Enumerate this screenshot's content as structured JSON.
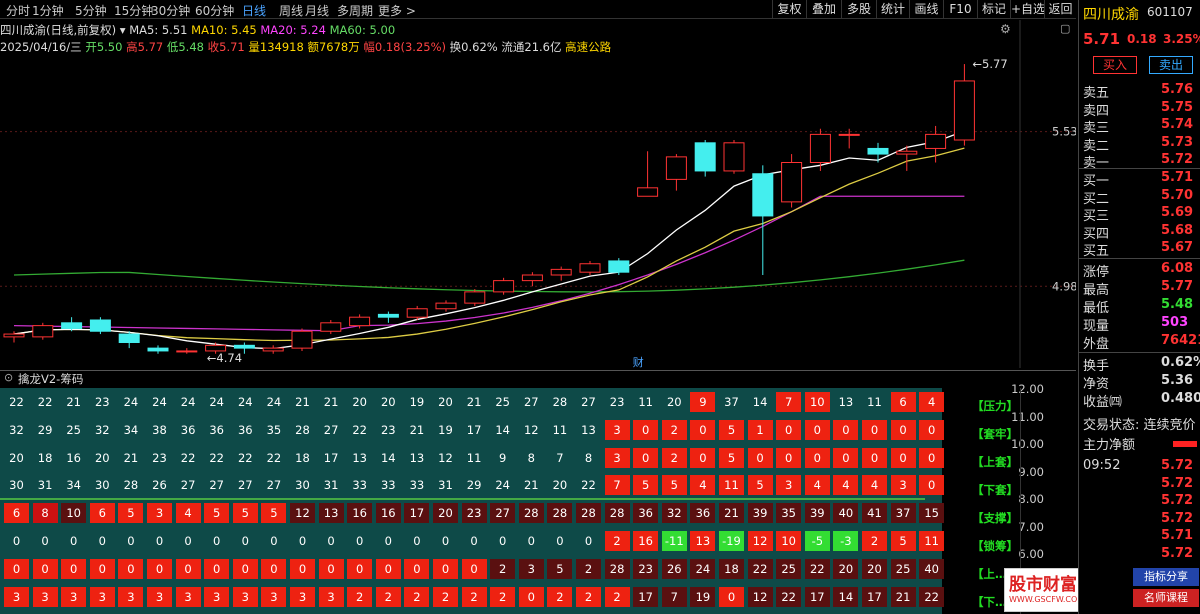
{
  "tabs": {
    "periods": [
      "分时",
      "1分钟",
      "5分钟",
      "15分钟",
      "30分钟",
      "60分钟",
      "日线",
      "周线",
      "月线",
      "多周期",
      "更多 >"
    ],
    "active": "日线",
    "buttons": [
      "复权",
      "叠加",
      "多股",
      "统计",
      "画线",
      "F10",
      "标记",
      "+自选",
      "返回"
    ]
  },
  "info": {
    "title": "四川成渝(日线,前复权)",
    "ma5": "MA5: 5.51",
    "ma10": "MA10: 5.45",
    "ma20": "MA20: 5.24",
    "ma60": "MA60: 5.00",
    "date": "2025/04/16/三",
    "open": "开5.50",
    "high": "高5.77",
    "low": "低5.48",
    "close": "收5.71",
    "vol": "量134918",
    "amount": "额7678万",
    "change": "幅0.18(3.25%)",
    "turnover": "换0.62%",
    "float": "流通21.6亿",
    "sector": "高速公路"
  },
  "chart_data": {
    "type": "candlestick",
    "price_axis": [
      "5.53",
      "4.98"
    ],
    "high_label": "5.77",
    "low_label": "4.74",
    "event_label": "财",
    "candles": [
      [
        4.8,
        4.81,
        4.82,
        4.78
      ],
      [
        4.8,
        4.84,
        4.85,
        4.79
      ],
      [
        4.85,
        4.83,
        4.87,
        4.82
      ],
      [
        4.86,
        4.82,
        4.87,
        4.81
      ],
      [
        4.81,
        4.78,
        4.82,
        4.76
      ],
      [
        4.76,
        4.75,
        4.77,
        4.74
      ],
      [
        4.75,
        4.75,
        4.76,
        4.74
      ],
      [
        4.75,
        4.77,
        4.78,
        4.74
      ],
      [
        4.77,
        4.76,
        4.78,
        4.74
      ],
      [
        4.75,
        4.76,
        4.77,
        4.74
      ],
      [
        4.76,
        4.82,
        4.83,
        4.75
      ],
      [
        4.82,
        4.85,
        4.86,
        4.81
      ],
      [
        4.84,
        4.87,
        4.88,
        4.83
      ],
      [
        4.88,
        4.87,
        4.89,
        4.85
      ],
      [
        4.87,
        4.9,
        4.91,
        4.86
      ],
      [
        4.9,
        4.92,
        4.93,
        4.89
      ],
      [
        4.92,
        4.96,
        4.97,
        4.91
      ],
      [
        4.96,
        5.0,
        5.01,
        4.95
      ],
      [
        5.0,
        5.02,
        5.03,
        4.98
      ],
      [
        5.02,
        5.04,
        5.05,
        5.0
      ],
      [
        5.03,
        5.06,
        5.07,
        5.02
      ],
      [
        5.07,
        5.03,
        5.08,
        5.02
      ],
      [
        5.3,
        5.33,
        5.46,
        5.3
      ],
      [
        5.36,
        5.44,
        5.45,
        5.32
      ],
      [
        5.49,
        5.39,
        5.5,
        5.37
      ],
      [
        5.39,
        5.49,
        5.5,
        5.38
      ],
      [
        5.38,
        5.23,
        5.41,
        5.02
      ],
      [
        5.28,
        5.42,
        5.45,
        5.26
      ],
      [
        5.42,
        5.52,
        5.54,
        5.39
      ],
      [
        5.52,
        5.52,
        5.54,
        5.47
      ],
      [
        5.47,
        5.45,
        5.49,
        5.42
      ],
      [
        5.45,
        5.46,
        5.48,
        5.39
      ],
      [
        5.47,
        5.52,
        5.55,
        5.42
      ],
      [
        5.5,
        5.71,
        5.77,
        5.48
      ]
    ]
  },
  "indicator": {
    "name": "擒龙V2-筹码",
    "axis": [
      "12.00",
      "11.00",
      "10.00",
      "9.00",
      "8.00",
      "7.00",
      "6.00"
    ],
    "tags": [
      "【压力】",
      "【套牢】",
      "【上套】",
      "【下套】",
      "【支撑】",
      "【锁筹】",
      "【上…】",
      "【下…】"
    ],
    "rows": [
      [
        "22",
        "22",
        "21",
        "23",
        "24",
        "24",
        "24",
        "24",
        "24",
        "24",
        "21",
        "21",
        "20",
        "20",
        "19",
        "20",
        "21",
        "25",
        "27",
        "28",
        "27",
        "23",
        "11",
        "20",
        "9",
        "37",
        "14",
        "7",
        "10",
        "13",
        "11",
        "6",
        "4"
      ],
      [
        "32",
        "29",
        "25",
        "32",
        "34",
        "38",
        "36",
        "36",
        "36",
        "35",
        "28",
        "27",
        "22",
        "23",
        "21",
        "19",
        "17",
        "14",
        "12",
        "11",
        "13",
        "3",
        "0",
        "2",
        "0",
        "5",
        "1",
        "0",
        "0",
        "0",
        "0",
        "0",
        "0"
      ],
      [
        "20",
        "18",
        "16",
        "20",
        "21",
        "23",
        "22",
        "22",
        "22",
        "22",
        "18",
        "17",
        "13",
        "14",
        "13",
        "12",
        "11",
        "9",
        "8",
        "7",
        "8",
        "3",
        "0",
        "2",
        "0",
        "5",
        "0",
        "0",
        "0",
        "0",
        "0",
        "0",
        "0"
      ],
      [
        "30",
        "31",
        "34",
        "30",
        "28",
        "26",
        "27",
        "27",
        "27",
        "27",
        "30",
        "31",
        "33",
        "33",
        "33",
        "31",
        "29",
        "24",
        "21",
        "20",
        "22",
        "7",
        "5",
        "5",
        "4",
        "11",
        "5",
        "3",
        "4",
        "4",
        "4",
        "3",
        "0"
      ],
      [
        "6",
        "8",
        "10",
        "6",
        "5",
        "3",
        "4",
        "5",
        "5",
        "5",
        "12",
        "13",
        "16",
        "16",
        "17",
        "20",
        "23",
        "27",
        "28",
        "28",
        "28",
        "28",
        "36",
        "32",
        "36",
        "21",
        "39",
        "35",
        "39",
        "40",
        "41",
        "37",
        "15"
      ],
      [
        "0",
        "0",
        "0",
        "0",
        "0",
        "0",
        "0",
        "0",
        "0",
        "0",
        "0",
        "0",
        "0",
        "0",
        "0",
        "0",
        "0",
        "0",
        "0",
        "0",
        "0",
        "2",
        "16",
        "-11",
        "13",
        "-19",
        "12",
        "10",
        "-5",
        "-3",
        "2",
        "5",
        "11"
      ],
      [
        "0",
        "0",
        "0",
        "0",
        "0",
        "0",
        "0",
        "0",
        "0",
        "0",
        "0",
        "0",
        "0",
        "0",
        "0",
        "0",
        "0",
        "2",
        "3",
        "5",
        "2",
        "28",
        "23",
        "26",
        "24",
        "18",
        "22",
        "25",
        "22",
        "20",
        "20",
        "25",
        "40"
      ],
      [
        "3",
        "3",
        "3",
        "3",
        "3",
        "3",
        "3",
        "3",
        "3",
        "3",
        "3",
        "3",
        "2",
        "2",
        "2",
        "2",
        "2",
        "2",
        "0",
        "2",
        "2",
        "2",
        "17",
        "7",
        "19",
        "0",
        "12",
        "22",
        "17",
        "14",
        "17",
        "21",
        "22"
      ]
    ]
  },
  "panel": {
    "name": "四川成渝",
    "code": "601107",
    "price": "5.71",
    "chg": "0.18",
    "pct": "3.25%",
    "buy_btn": "买入",
    "sell_btn": "卖出",
    "asks": [
      [
        "卖五",
        "5.76"
      ],
      [
        "卖四",
        "5.75"
      ],
      [
        "卖三",
        "5.74"
      ],
      [
        "卖二",
        "5.73"
      ],
      [
        "卖一",
        "5.72"
      ]
    ],
    "bids": [
      [
        "买一",
        "5.71"
      ],
      [
        "买二",
        "5.70"
      ],
      [
        "买三",
        "5.69"
      ],
      [
        "买四",
        "5.68"
      ],
      [
        "买五",
        "5.67"
      ]
    ],
    "stats": [
      [
        "涨停",
        "6.08"
      ],
      [
        "最高",
        "5.77"
      ],
      [
        "最低",
        "5.48"
      ],
      [
        "现量",
        "503"
      ],
      [
        "外盘",
        "76421"
      ]
    ],
    "stats2": [
      [
        "换手",
        "0.62%"
      ],
      [
        "净资",
        "5.36"
      ],
      [
        "收益㈣",
        "0.480"
      ]
    ],
    "status": "交易状态: 连续竞价",
    "flow": "主力净额",
    "ticks": [
      [
        "09:52",
        "5.72"
      ],
      [
        "",
        "5.72"
      ],
      [
        "",
        "5.72"
      ],
      [
        "",
        "5.72"
      ],
      [
        "",
        "5.71"
      ],
      [
        "",
        "5.72"
      ]
    ]
  },
  "watermark": {
    "line1": "股市财富网",
    "line2": "WWW.GSCFW.COM",
    "tag1": "指标分享",
    "tag2": "名师课程"
  }
}
